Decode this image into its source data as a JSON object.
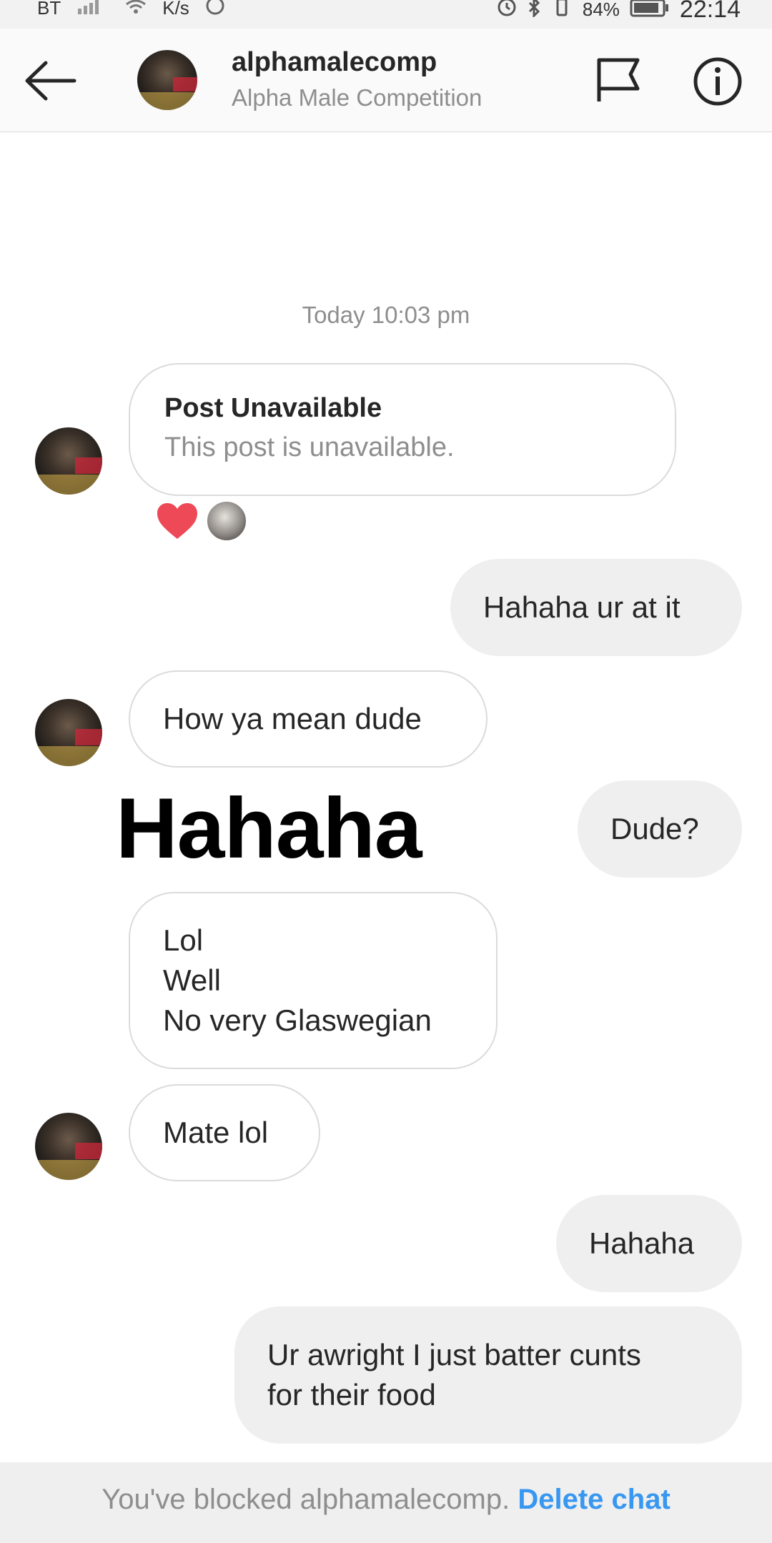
{
  "status_bar": {
    "carrier": "BT",
    "speed": "K/s",
    "battery": "84%",
    "time": "22:14"
  },
  "header": {
    "username": "alphamalecomp",
    "full_name": "Alpha Male Competition"
  },
  "thread": {
    "timestamp": "Today 10:03 pm",
    "shared_post": {
      "title": "Post Unavailable",
      "subtitle": "This post is unavailable."
    },
    "messages": [
      {
        "text": "Hahaha ur at it"
      },
      {
        "text": "How ya mean dude"
      },
      {
        "text": "Dude?"
      },
      {
        "lines": [
          "Lol",
          "Well",
          "No very Glaswegian"
        ]
      },
      {
        "text": "Mate lol"
      },
      {
        "text": "Hahaha"
      },
      {
        "lines": [
          "Ur awright I just batter cunts",
          "for their food"
        ]
      }
    ],
    "overlay_text": "Hahaha"
  },
  "footer": {
    "blocked_text": "You've blocked alphamalecomp.",
    "delete_label": "Delete chat"
  },
  "colors": {
    "accent_blue": "#3897f0",
    "heart_red": "#ed4956",
    "bubble_out": "#efefef",
    "border": "#dbdbdb",
    "muted_text": "#8e8e8e"
  }
}
